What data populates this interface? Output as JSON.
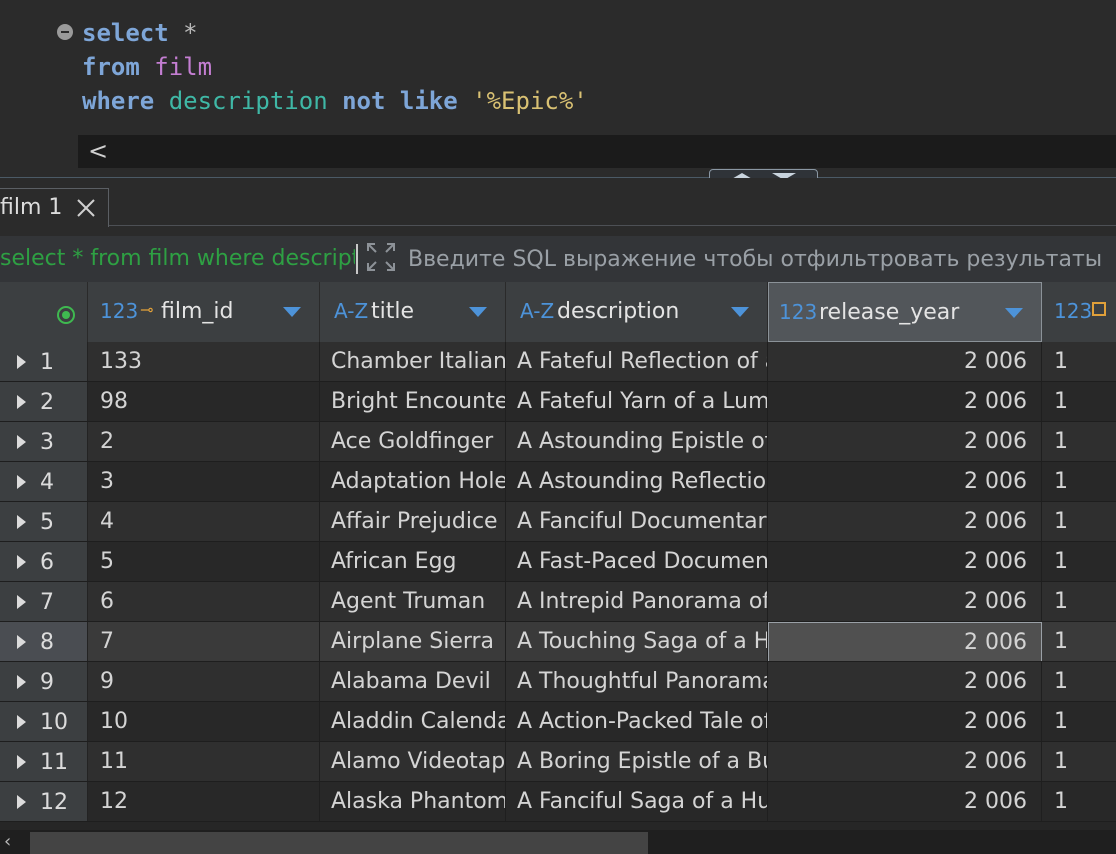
{
  "editor": {
    "line1": {
      "kw": "select",
      "op": " *"
    },
    "line2": {
      "kw": "from",
      "tbl": "film"
    },
    "line3": {
      "kw": "where",
      "col": "description",
      "kw2": "not like",
      "str": "'%Epic%'"
    },
    "scroll_left": "<"
  },
  "result_tab": {
    "label": "film 1"
  },
  "filter": {
    "query": "select * from film where description not like '%Epic%'",
    "placeholder": "Введите SQL выражение чтобы отфильтровать результаты"
  },
  "columns": [
    {
      "type": "123",
      "label": "film_id"
    },
    {
      "type": "A-Z",
      "label": "title"
    },
    {
      "type": "A-Z",
      "label": "description"
    },
    {
      "type": "123",
      "label": "release_year"
    },
    {
      "type": "123",
      "label": ""
    }
  ],
  "rows": [
    {
      "n": "1",
      "film_id": "133",
      "title": "Chamber Italian",
      "description": "A Fateful Reflection of a",
      "release_year": "2 006",
      "lang": "1"
    },
    {
      "n": "2",
      "film_id": "98",
      "title": "Bright Encounters",
      "description": "A Fateful Yarn of a Lum",
      "release_year": "2 006",
      "lang": "1"
    },
    {
      "n": "3",
      "film_id": "2",
      "title": "Ace Goldfinger",
      "description": "A Astounding Epistle of",
      "release_year": "2 006",
      "lang": "1"
    },
    {
      "n": "4",
      "film_id": "3",
      "title": "Adaptation Holes",
      "description": "A Astounding Reflection",
      "release_year": "2 006",
      "lang": "1"
    },
    {
      "n": "5",
      "film_id": "4",
      "title": "Affair Prejudice",
      "description": "A Fanciful Documentary",
      "release_year": "2 006",
      "lang": "1"
    },
    {
      "n": "6",
      "film_id": "5",
      "title": "African Egg",
      "description": "A Fast-Paced Document",
      "release_year": "2 006",
      "lang": "1"
    },
    {
      "n": "7",
      "film_id": "6",
      "title": "Agent Truman",
      "description": "A Intrepid Panorama of",
      "release_year": "2 006",
      "lang": "1"
    },
    {
      "n": "8",
      "film_id": "7",
      "title": "Airplane Sierra",
      "description": "A Touching Saga of a H",
      "release_year": "2 006",
      "lang": "1"
    },
    {
      "n": "9",
      "film_id": "9",
      "title": "Alabama Devil",
      "description": "A Thoughtful Panorama",
      "release_year": "2 006",
      "lang": "1"
    },
    {
      "n": "10",
      "film_id": "10",
      "title": "Aladdin Calendar",
      "description": "A Action-Packed Tale of",
      "release_year": "2 006",
      "lang": "1"
    },
    {
      "n": "11",
      "film_id": "11",
      "title": "Alamo Videotape",
      "description": "A Boring Epistle of a Bu",
      "release_year": "2 006",
      "lang": "1"
    },
    {
      "n": "12",
      "film_id": "12",
      "title": "Alaska Phantom",
      "description": "A Fanciful Saga of a Hu",
      "release_year": "2 006",
      "lang": "1"
    }
  ],
  "selected_row": 8
}
